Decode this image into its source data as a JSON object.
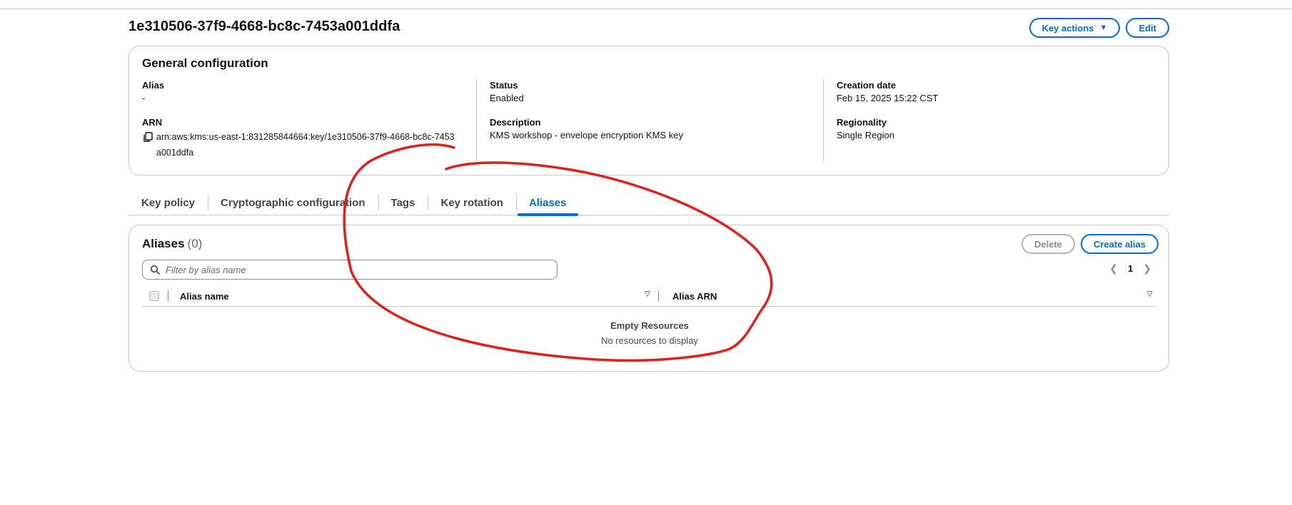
{
  "key": {
    "id": "1e310506-37f9-4668-bc8c-7453a001ddfa"
  },
  "header": {
    "key_actions_label": "Key actions",
    "edit_label": "Edit"
  },
  "general_configuration": {
    "title": "General configuration",
    "alias_label": "Alias",
    "alias_value": "-",
    "arn_label": "ARN",
    "arn_value": "arn:aws:kms:us-east-1:831285844664:key/1e310506-37f9-4668-bc8c-7453a001ddfa",
    "status_label": "Status",
    "status_value": "Enabled",
    "description_label": "Description",
    "description_value": "KMS workshop - envelope encryption KMS key",
    "creation_date_label": "Creation date",
    "creation_date_value": "Feb 15, 2025 15:22 CST",
    "regionality_label": "Regionality",
    "regionality_value": "Single Region"
  },
  "tabs": [
    {
      "label": "Key policy",
      "active": false
    },
    {
      "label": "Cryptographic configuration",
      "active": false
    },
    {
      "label": "Tags",
      "active": false
    },
    {
      "label": "Key rotation",
      "active": false
    },
    {
      "label": "Aliases",
      "active": true
    }
  ],
  "aliases": {
    "title": "Aliases",
    "count": "(0)",
    "delete_label": "Delete",
    "create_label": "Create alias",
    "filter_placeholder": "Filter by alias name",
    "page_number": "1",
    "columns": [
      "Alias name",
      "Alias ARN"
    ],
    "empty_title": "Empty Resources",
    "empty_subtitle": "No resources to display"
  },
  "annotation": {
    "color": "#e0201b"
  },
  "colors": {
    "accent": "#006ce0",
    "border": "#c6c6cd",
    "text": "#0f141a"
  }
}
